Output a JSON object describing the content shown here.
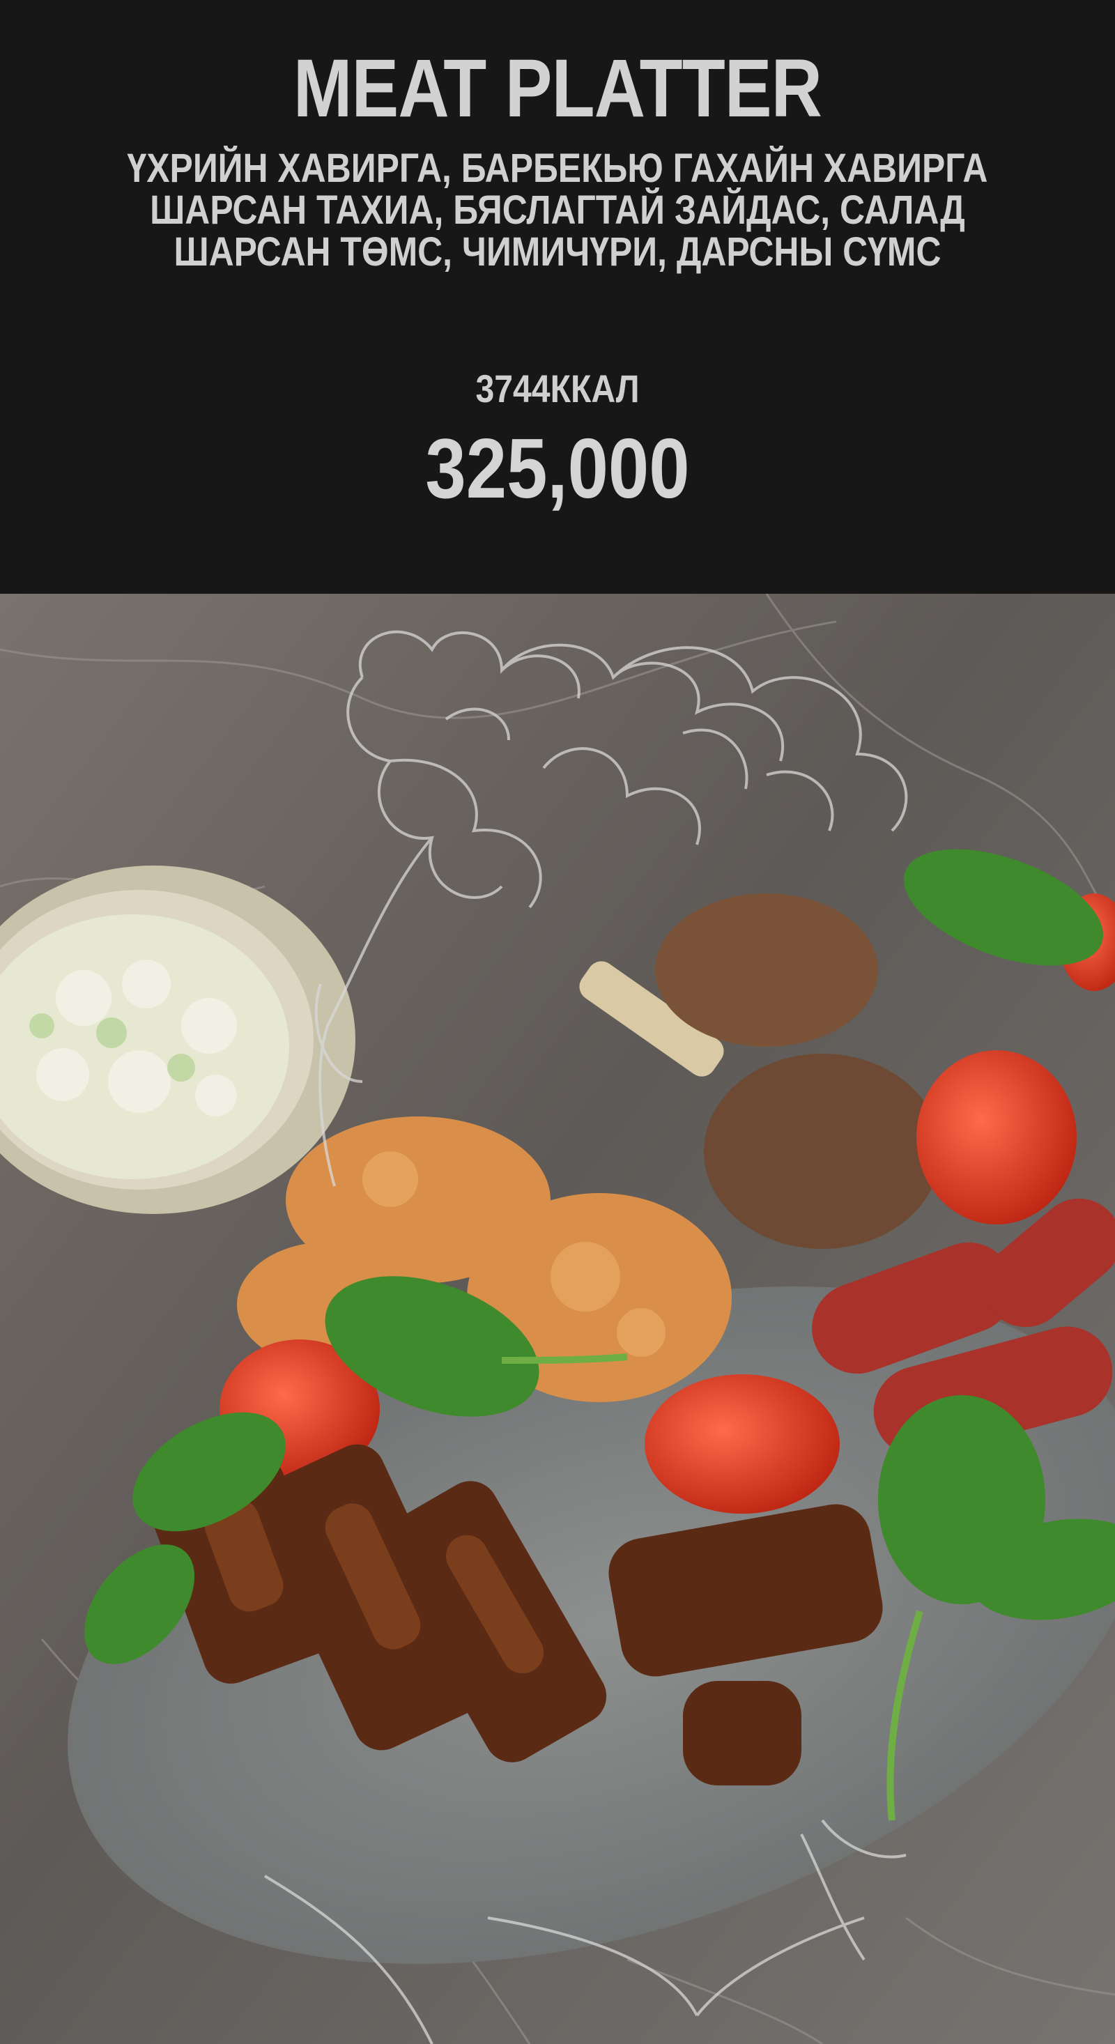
{
  "dish": {
    "title": "MEAT PLATTER",
    "description_lines": [
      "ҮХРИЙН ХАВИРГА, БАРБЕКЬЮ ГАХАЙН ХАВИРГА",
      "ШАРСАН ТАХИА, БЯСЛАГТАЙ ЗАЙДАС, САЛАД",
      "ШАРСАН ТӨМС, ЧИМИЧҮРИ, ДАРСНЫ СҮМС"
    ],
    "calories": "3744ККАЛ",
    "price": "325,000"
  },
  "photo": {
    "subject": "meat platter on grey plate with caesar salad bowl on marble table"
  },
  "colors": {
    "header_bg": "#171717",
    "text": "#d0d0d0",
    "marble": "#6f6a66",
    "plate": "#8e9090"
  }
}
